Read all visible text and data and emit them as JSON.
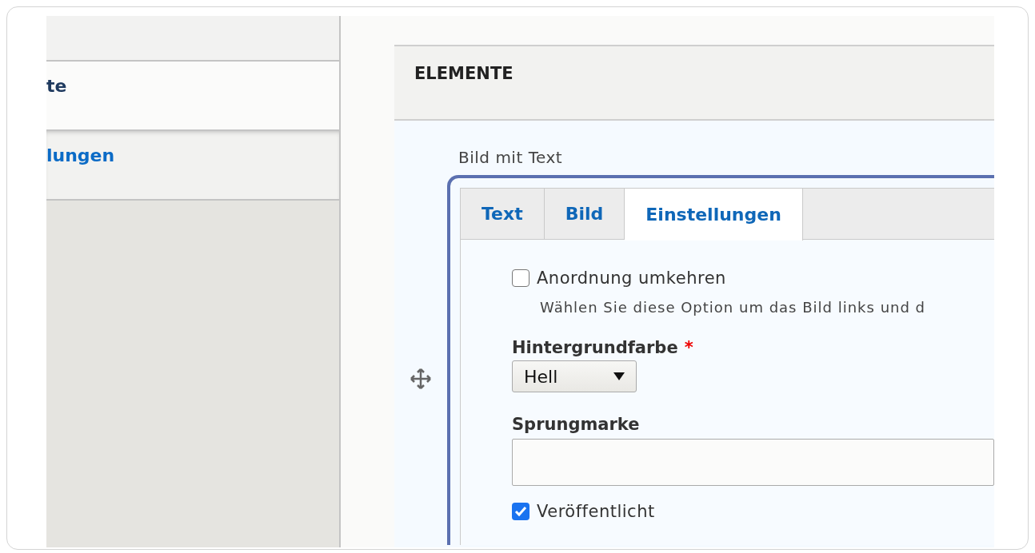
{
  "sidebar": {
    "items": [
      {
        "label": "te",
        "selected": true
      },
      {
        "label": "lungen",
        "selected": false
      }
    ]
  },
  "panel": {
    "title": "ELEMENTE",
    "paragraph": {
      "label": "Bild mit Text",
      "tabs": [
        {
          "label": "Text",
          "selected": false
        },
        {
          "label": "Bild",
          "selected": false
        },
        {
          "label": "Einstellungen",
          "selected": true
        }
      ],
      "fields": [
        {
          "kind": "checkbox",
          "label": "Anordnung umkehren",
          "checked": false,
          "description": "Wählen Sie diese Option um das Bild links und d"
        },
        {
          "kind": "select",
          "label": "Hintergrundfarbe",
          "required_mark": "*",
          "value": "Hell"
        },
        {
          "kind": "text",
          "label": "Sprungmarke"
        },
        {
          "kind": "checkbox",
          "label": "Veröffentlicht",
          "checked": true
        }
      ]
    }
  }
}
